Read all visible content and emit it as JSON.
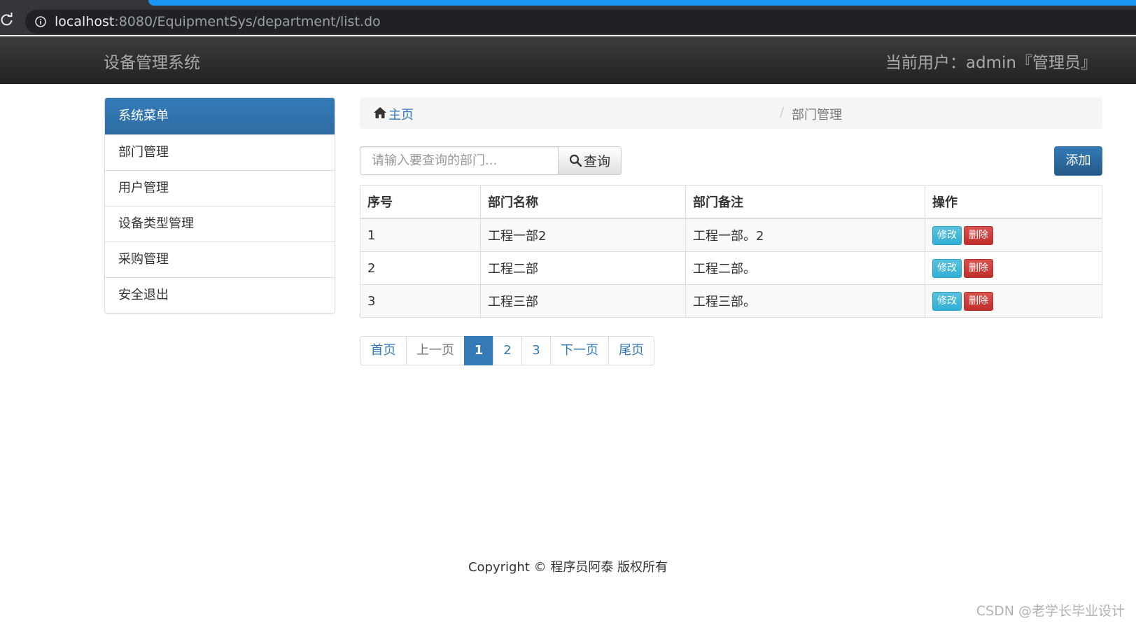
{
  "browser": {
    "url_host": "localhost",
    "url_rest": ":8080/EquipmentSys/department/list.do"
  },
  "navbar": {
    "brand": "设备管理系统",
    "current_user": "当前用户：admin『管理员』"
  },
  "sidebar": {
    "heading": "系统菜单",
    "items": [
      {
        "label": "部门管理"
      },
      {
        "label": "用户管理"
      },
      {
        "label": "设备类型管理"
      },
      {
        "label": "采购管理"
      },
      {
        "label": "安全退出"
      }
    ]
  },
  "breadcrumb": {
    "home": "主页",
    "separator": "/",
    "current": "部门管理"
  },
  "search": {
    "placeholder": "请输入要查询的部门...",
    "button_label": "查询"
  },
  "toolbar": {
    "add_label": "添加"
  },
  "table": {
    "headers": [
      "序号",
      "部门名称",
      "部门备注",
      "操作"
    ],
    "rows": [
      {
        "index": "1",
        "name": "工程一部2",
        "note": "工程一部。2"
      },
      {
        "index": "2",
        "name": "工程二部",
        "note": "工程二部。"
      },
      {
        "index": "3",
        "name": "工程三部",
        "note": "工程三部。"
      }
    ],
    "edit_label": "修改",
    "delete_label": "删除"
  },
  "pagination": {
    "first": "首页",
    "prev": "上一页",
    "pages": [
      "1",
      "2",
      "3"
    ],
    "current_page": "1",
    "next": "下一页",
    "last": "尾页"
  },
  "footer": {
    "copyright": "Copyright © 程序员阿泰 版权所有"
  },
  "watermark": {
    "text": "CSDN @老学长毕业设计"
  },
  "colors": {
    "primary": "#337ab7",
    "info": "#5bc0de",
    "danger": "#d9534f",
    "navbar": "#222222",
    "progress": "#1a95f2"
  },
  "icons": {
    "reload": "reload-icon",
    "info": "info-icon",
    "home": "home-icon",
    "search": "search-icon"
  }
}
